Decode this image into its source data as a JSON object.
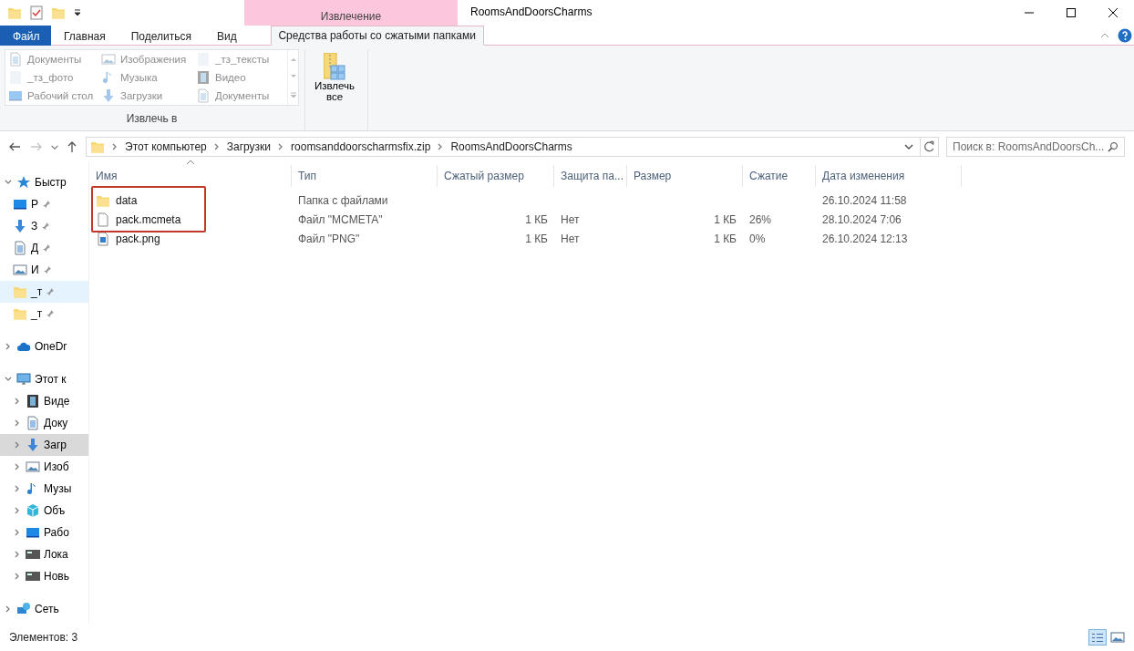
{
  "window": {
    "title": "RoomsAndDoorsCharms",
    "context_tab_group": "Извлечение"
  },
  "ribbon_tabs": [
    {
      "label": "Файл",
      "kind": "file",
      "selected": false
    },
    {
      "label": "Главная",
      "kind": "tab",
      "selected": false
    },
    {
      "label": "Поделиться",
      "kind": "tab",
      "selected": false
    },
    {
      "label": "Вид",
      "kind": "tab",
      "selected": false
    },
    {
      "label": "Средства работы со сжатыми папками",
      "kind": "context",
      "selected": true
    }
  ],
  "ribbon": {
    "locations": [
      {
        "label": "Документы",
        "kind": "document"
      },
      {
        "label": "_тз_фото",
        "kind": "blank"
      },
      {
        "label": "Рабочий стол",
        "kind": "desktop"
      },
      {
        "label": "Изображения",
        "kind": "image"
      },
      {
        "label": "Музыка",
        "kind": "music"
      },
      {
        "label": "Загрузки",
        "kind": "download"
      },
      {
        "label": "_тз_тексты",
        "kind": "blank"
      },
      {
        "label": "Видео",
        "kind": "video"
      },
      {
        "label": "Документы",
        "kind": "document"
      }
    ],
    "locations_disabled": true,
    "group_label": "Извлечь в",
    "extract_button": {
      "line1": "Извлечь",
      "line2": "все"
    }
  },
  "address": {
    "path": [
      "Этот компьютер",
      "Загрузки",
      "roomsanddoorscharmsfix.zip",
      "RoomsAndDoorsCharms"
    ],
    "search_placeholder": "Поиск в: RoomsAndDoorsCh..."
  },
  "sidebar": {
    "items": [
      {
        "label": "Быстр",
        "kind": "star",
        "expanded": true,
        "selected": false,
        "children": [
          {
            "label": "Р",
            "kind": "desktop",
            "pinned": true,
            "selected": false
          },
          {
            "label": "З",
            "kind": "download",
            "pinned": true,
            "selected": false
          },
          {
            "label": "Д",
            "kind": "document",
            "pinned": true,
            "selected": false
          },
          {
            "label": "И",
            "kind": "image",
            "pinned": true,
            "selected": false
          },
          {
            "label": "_т",
            "kind": "folder",
            "pinned": true,
            "selected": true
          },
          {
            "label": "_т",
            "kind": "folder",
            "pinned": true,
            "selected": false
          }
        ]
      },
      {
        "label": "OneDr",
        "kind": "cloud",
        "expanded": false,
        "selected": false
      },
      {
        "label": "Этот к",
        "kind": "computer",
        "expanded": true,
        "selected": false,
        "children": [
          {
            "label": "Виде",
            "kind": "video",
            "pinned": false,
            "selected": false
          },
          {
            "label": "Доку",
            "kind": "document",
            "pinned": false,
            "selected": false
          },
          {
            "label": "Загр",
            "kind": "download",
            "pinned": false,
            "selected": true
          },
          {
            "label": "Изоб",
            "kind": "image",
            "pinned": false,
            "selected": false
          },
          {
            "label": "Музы",
            "kind": "music",
            "pinned": false,
            "selected": false
          },
          {
            "label": "Объ",
            "kind": "cube",
            "pinned": false,
            "selected": false
          },
          {
            "label": "Рабо",
            "kind": "desktop",
            "pinned": false,
            "selected": false
          },
          {
            "label": "Лока",
            "kind": "drive",
            "pinned": false,
            "selected": false
          },
          {
            "label": "Новь",
            "kind": "drive",
            "pinned": false,
            "selected": false
          }
        ]
      },
      {
        "label": "Сеть",
        "kind": "network",
        "expanded": false,
        "selected": false
      }
    ]
  },
  "table": {
    "columns": [
      "Имя",
      "Тип",
      "Сжатый размер",
      "Защита па...",
      "Размер",
      "Сжатие",
      "Дата изменения"
    ],
    "rows": [
      {
        "kind": "folder",
        "annotated": true,
        "cells": [
          "data",
          "Папка с файлами",
          "",
          "",
          "",
          "",
          "26.10.2024 11:58"
        ]
      },
      {
        "kind": "file",
        "annotated": true,
        "cells": [
          "pack.mcmeta",
          "Файл \"MCMETA\"",
          "1 КБ",
          "Нет",
          "1 КБ",
          "26%",
          "28.10.2024 7:06"
        ]
      },
      {
        "kind": "png",
        "annotated": false,
        "cells": [
          "pack.png",
          "Файл \"PNG\"",
          "1 КБ",
          "Нет",
          "1 КБ",
          "0%",
          "26.10.2024 12:13"
        ]
      }
    ]
  },
  "status_bar": {
    "text": "Элементов: 3",
    "view_buttons": [
      {
        "kind": "details",
        "selected": true
      },
      {
        "kind": "thumbnails",
        "selected": false
      }
    ]
  }
}
